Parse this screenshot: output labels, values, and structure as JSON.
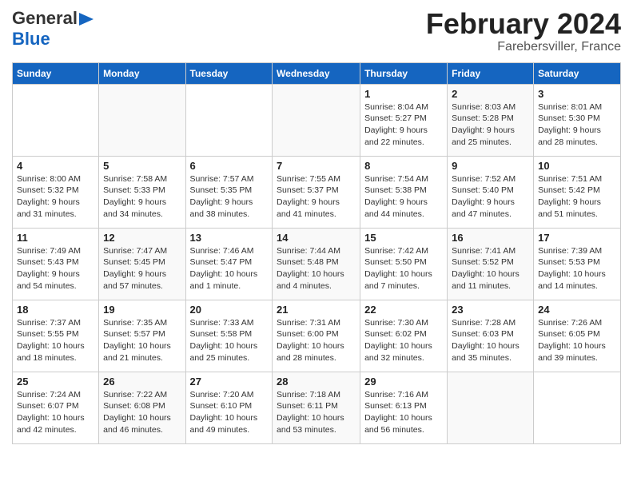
{
  "header": {
    "logo_general": "General",
    "logo_blue": "Blue",
    "title": "February 2024",
    "subtitle": "Farebersviller, France"
  },
  "days_of_week": [
    "Sunday",
    "Monday",
    "Tuesday",
    "Wednesday",
    "Thursday",
    "Friday",
    "Saturday"
  ],
  "weeks": [
    [
      {
        "day": "",
        "info": ""
      },
      {
        "day": "",
        "info": ""
      },
      {
        "day": "",
        "info": ""
      },
      {
        "day": "",
        "info": ""
      },
      {
        "day": "1",
        "info": "Sunrise: 8:04 AM\nSunset: 5:27 PM\nDaylight: 9 hours\nand 22 minutes."
      },
      {
        "day": "2",
        "info": "Sunrise: 8:03 AM\nSunset: 5:28 PM\nDaylight: 9 hours\nand 25 minutes."
      },
      {
        "day": "3",
        "info": "Sunrise: 8:01 AM\nSunset: 5:30 PM\nDaylight: 9 hours\nand 28 minutes."
      }
    ],
    [
      {
        "day": "4",
        "info": "Sunrise: 8:00 AM\nSunset: 5:32 PM\nDaylight: 9 hours\nand 31 minutes."
      },
      {
        "day": "5",
        "info": "Sunrise: 7:58 AM\nSunset: 5:33 PM\nDaylight: 9 hours\nand 34 minutes."
      },
      {
        "day": "6",
        "info": "Sunrise: 7:57 AM\nSunset: 5:35 PM\nDaylight: 9 hours\nand 38 minutes."
      },
      {
        "day": "7",
        "info": "Sunrise: 7:55 AM\nSunset: 5:37 PM\nDaylight: 9 hours\nand 41 minutes."
      },
      {
        "day": "8",
        "info": "Sunrise: 7:54 AM\nSunset: 5:38 PM\nDaylight: 9 hours\nand 44 minutes."
      },
      {
        "day": "9",
        "info": "Sunrise: 7:52 AM\nSunset: 5:40 PM\nDaylight: 9 hours\nand 47 minutes."
      },
      {
        "day": "10",
        "info": "Sunrise: 7:51 AM\nSunset: 5:42 PM\nDaylight: 9 hours\nand 51 minutes."
      }
    ],
    [
      {
        "day": "11",
        "info": "Sunrise: 7:49 AM\nSunset: 5:43 PM\nDaylight: 9 hours\nand 54 minutes."
      },
      {
        "day": "12",
        "info": "Sunrise: 7:47 AM\nSunset: 5:45 PM\nDaylight: 9 hours\nand 57 minutes."
      },
      {
        "day": "13",
        "info": "Sunrise: 7:46 AM\nSunset: 5:47 PM\nDaylight: 10 hours\nand 1 minute."
      },
      {
        "day": "14",
        "info": "Sunrise: 7:44 AM\nSunset: 5:48 PM\nDaylight: 10 hours\nand 4 minutes."
      },
      {
        "day": "15",
        "info": "Sunrise: 7:42 AM\nSunset: 5:50 PM\nDaylight: 10 hours\nand 7 minutes."
      },
      {
        "day": "16",
        "info": "Sunrise: 7:41 AM\nSunset: 5:52 PM\nDaylight: 10 hours\nand 11 minutes."
      },
      {
        "day": "17",
        "info": "Sunrise: 7:39 AM\nSunset: 5:53 PM\nDaylight: 10 hours\nand 14 minutes."
      }
    ],
    [
      {
        "day": "18",
        "info": "Sunrise: 7:37 AM\nSunset: 5:55 PM\nDaylight: 10 hours\nand 18 minutes."
      },
      {
        "day": "19",
        "info": "Sunrise: 7:35 AM\nSunset: 5:57 PM\nDaylight: 10 hours\nand 21 minutes."
      },
      {
        "day": "20",
        "info": "Sunrise: 7:33 AM\nSunset: 5:58 PM\nDaylight: 10 hours\nand 25 minutes."
      },
      {
        "day": "21",
        "info": "Sunrise: 7:31 AM\nSunset: 6:00 PM\nDaylight: 10 hours\nand 28 minutes."
      },
      {
        "day": "22",
        "info": "Sunrise: 7:30 AM\nSunset: 6:02 PM\nDaylight: 10 hours\nand 32 minutes."
      },
      {
        "day": "23",
        "info": "Sunrise: 7:28 AM\nSunset: 6:03 PM\nDaylight: 10 hours\nand 35 minutes."
      },
      {
        "day": "24",
        "info": "Sunrise: 7:26 AM\nSunset: 6:05 PM\nDaylight: 10 hours\nand 39 minutes."
      }
    ],
    [
      {
        "day": "25",
        "info": "Sunrise: 7:24 AM\nSunset: 6:07 PM\nDaylight: 10 hours\nand 42 minutes."
      },
      {
        "day": "26",
        "info": "Sunrise: 7:22 AM\nSunset: 6:08 PM\nDaylight: 10 hours\nand 46 minutes."
      },
      {
        "day": "27",
        "info": "Sunrise: 7:20 AM\nSunset: 6:10 PM\nDaylight: 10 hours\nand 49 minutes."
      },
      {
        "day": "28",
        "info": "Sunrise: 7:18 AM\nSunset: 6:11 PM\nDaylight: 10 hours\nand 53 minutes."
      },
      {
        "day": "29",
        "info": "Sunrise: 7:16 AM\nSunset: 6:13 PM\nDaylight: 10 hours\nand 56 minutes."
      },
      {
        "day": "",
        "info": ""
      },
      {
        "day": "",
        "info": ""
      }
    ]
  ]
}
